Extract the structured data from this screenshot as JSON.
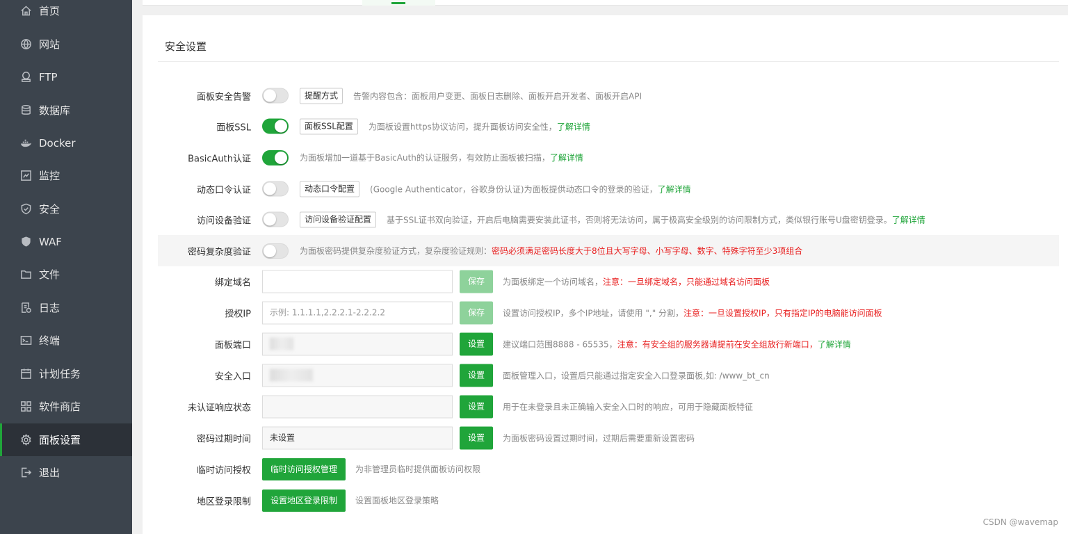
{
  "sidebar": {
    "items": [
      {
        "label": "首页",
        "icon": "home-icon"
      },
      {
        "label": "网站",
        "icon": "globe-icon"
      },
      {
        "label": "FTP",
        "icon": "ftp-icon"
      },
      {
        "label": "数据库",
        "icon": "database-icon"
      },
      {
        "label": "Docker",
        "icon": "docker-icon"
      },
      {
        "label": "监控",
        "icon": "monitor-icon"
      },
      {
        "label": "安全",
        "icon": "shield-icon"
      },
      {
        "label": "WAF",
        "icon": "waf-shield-icon"
      },
      {
        "label": "文件",
        "icon": "folder-icon"
      },
      {
        "label": "日志",
        "icon": "log-icon"
      },
      {
        "label": "终端",
        "icon": "terminal-icon"
      },
      {
        "label": "计划任务",
        "icon": "calendar-icon"
      },
      {
        "label": "软件商店",
        "icon": "grid-icon"
      },
      {
        "label": "面板设置",
        "icon": "gear-icon",
        "active": true
      },
      {
        "label": "退出",
        "icon": "logout-icon"
      }
    ]
  },
  "colors": {
    "accent": "#20a53a",
    "warn": "#e81f1f",
    "sidebar": "#3c444d"
  },
  "main": {
    "section_title": "安全设置",
    "panel_alert": {
      "label": "面板安全告警",
      "button": "提醒方式",
      "desc": "告警内容包含：面板用户变更、面板日志删除、面板开启开发者、面板开启API"
    },
    "panel_ssl": {
      "label": "面板SSL",
      "button": "面板SSL配置",
      "desc": "为面板设置https协议访问，提升面板访问安全性，",
      "link": "了解详情"
    },
    "basic_auth": {
      "label": "BasicAuth认证",
      "desc": "为面板增加一道基于BasicAuth的认证服务，有效防止面板被扫描，",
      "link": "了解详情"
    },
    "dynamic_code": {
      "label": "动态口令认证",
      "button": "动态口令配置",
      "desc": "(Google Authenticator，谷歌身份认证)为面板提供动态口令的登录的验证，",
      "link": "了解详情"
    },
    "device_verify": {
      "label": "访问设备验证",
      "button": "访问设备验证配置",
      "desc": "基于SSL证书双向验证，开启后电脑需要安装此证书，否则将无法访问，属于极高安全级别的访问限制方式，类似银行账号U盘密钥登录。",
      "link": "了解详情"
    },
    "password_complexity": {
      "label": "密码复杂度验证",
      "desc": "为面板密码提供复杂度验证方式，复杂度验证规则：",
      "warn": "密码必须满足密码长度大于8位且大写字母、小写字母、数字、特殊字符至少3项组合"
    },
    "bind_domain": {
      "label": "绑定域名",
      "value": "",
      "button": "保存",
      "desc": "为面板绑定一个访问域名，",
      "warn": "注意：一旦绑定域名，只能通过域名访问面板"
    },
    "auth_ip": {
      "label": "授权IP",
      "placeholder": "示例: 1.1.1.1,2.2.2.1-2.2.2.2",
      "button": "保存",
      "desc": "设置访问授权IP，多个IP地址，请使用 \",\" 分割，",
      "warn": "注意：一旦设置授权IP，只有指定IP的电脑能访问面板"
    },
    "panel_port": {
      "label": "面板端口",
      "button": "设置",
      "desc": "建议端口范围8888 - 65535，",
      "warn": "注意：有安全组的服务器请提前在安全组放行新端口，",
      "link": "了解详情"
    },
    "safe_entry": {
      "label": "安全入口",
      "button": "设置",
      "desc": "面板管理入口，设置后只能通过指定安全入口登录面板,如: /www_bt_cn"
    },
    "unauth_status": {
      "label": "未认证响应状态",
      "value": "",
      "button": "设置",
      "desc": "用于在未登录且未正确输入安全入口时的响应，可用于隐藏面板特征"
    },
    "password_expire": {
      "label": "密码过期时间",
      "value": "未设置",
      "button": "设置",
      "desc": "为面板密码设置过期时间，过期后需要重新设置密码"
    },
    "temp_access": {
      "label": "临时访问授权",
      "button": "临时访问授权管理",
      "desc": "为非管理员临时提供面板访问权限"
    },
    "region_limit": {
      "label": "地区登录限制",
      "button": "设置地区登录限制",
      "desc": "设置面板地区登录策略"
    }
  },
  "watermark": "CSDN @wavemap"
}
